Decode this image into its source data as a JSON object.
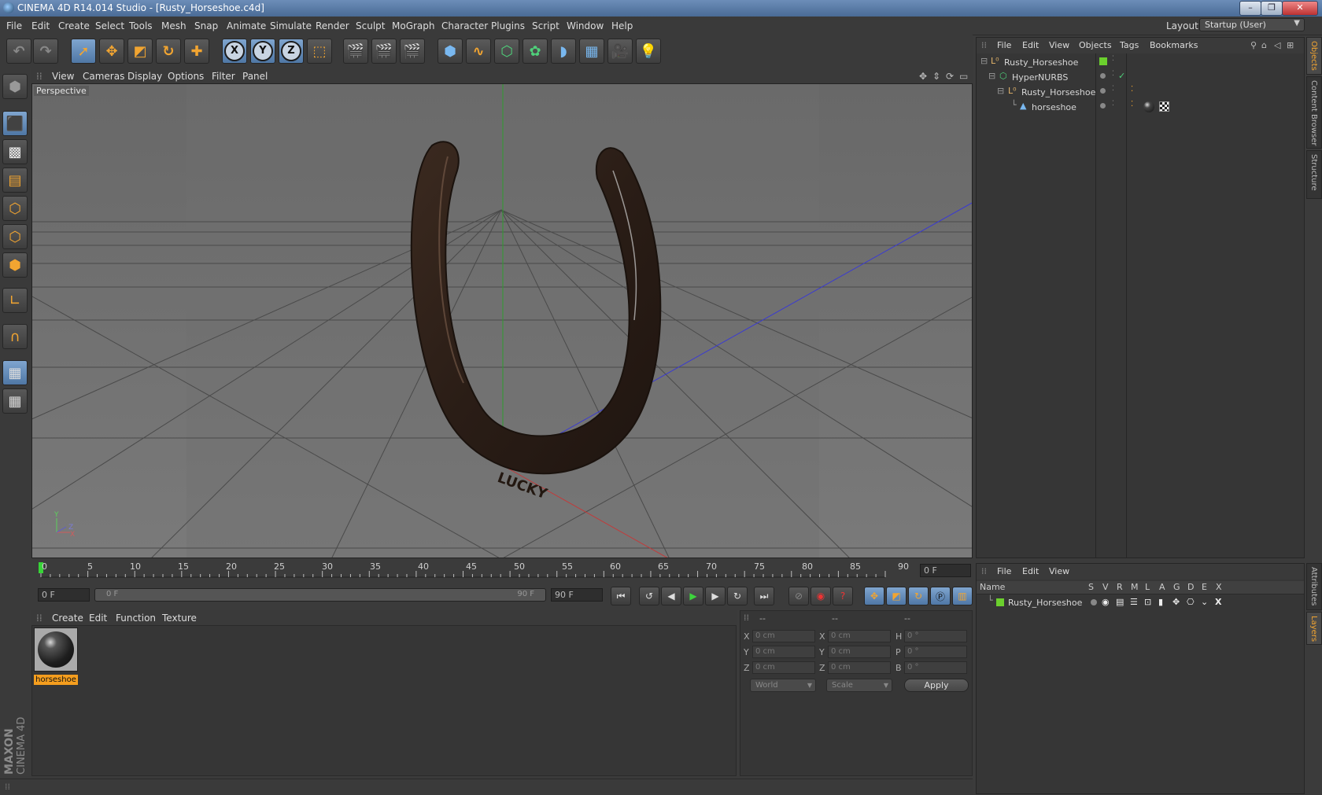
{
  "window": {
    "title": "CINEMA 4D R14.014 Studio - [Rusty_Horseshoe.c4d]"
  },
  "menubar": {
    "items": [
      "File",
      "Edit",
      "Create",
      "Select",
      "Tools",
      "Mesh",
      "Snap",
      "Animate",
      "Simulate",
      "Render",
      "Sculpt",
      "MoGraph",
      "Character",
      "Plugins",
      "Script",
      "Window",
      "Help"
    ],
    "layout_label": "Layout:",
    "layout_value": "Startup (User)"
  },
  "toolbar": {
    "axis_x": "X",
    "axis_y": "Y",
    "axis_z": "Z"
  },
  "viewport": {
    "menu": [
      "View",
      "Cameras",
      "Display",
      "Options",
      "Filter",
      "Panel"
    ],
    "label": "Perspective",
    "axis_y": "Y",
    "axis_x": "X",
    "axis_z": "Z",
    "object_text": "LUCKY"
  },
  "timeline": {
    "ticks": [
      "0",
      "5",
      "10",
      "15",
      "20",
      "25",
      "30",
      "35",
      "40",
      "45",
      "50",
      "55",
      "60",
      "65",
      "70",
      "75",
      "80",
      "85",
      "90"
    ],
    "current_frame": "0 F"
  },
  "playbar": {
    "start_field": "0 F",
    "range_start": "0 F",
    "range_end": "90 F",
    "end_field": "90 F"
  },
  "material_manager": {
    "menu": [
      "Create",
      "Edit",
      "Function",
      "Texture"
    ],
    "materials": [
      {
        "name": "horseshoe"
      }
    ]
  },
  "coordinates": {
    "header": [
      "--",
      "--",
      "--"
    ],
    "rows": [
      {
        "l1": "X",
        "v1": "0 cm",
        "l2": "X",
        "v2": "0 cm",
        "l3": "H",
        "v3": "0 °"
      },
      {
        "l1": "Y",
        "v1": "0 cm",
        "l2": "Y",
        "v2": "0 cm",
        "l3": "P",
        "v3": "0 °"
      },
      {
        "l1": "Z",
        "v1": "0 cm",
        "l2": "Z",
        "v2": "0 cm",
        "l3": "B",
        "v3": "0 °"
      }
    ],
    "mode_dropdown": "World",
    "scale_dropdown": "Scale",
    "apply_label": "Apply"
  },
  "object_manager": {
    "menu": [
      "File",
      "Edit",
      "View",
      "Objects",
      "Tags",
      "Bookmarks"
    ],
    "objects": [
      {
        "name": "Rusty_Horseshoe"
      },
      {
        "name": "HyperNURBS"
      },
      {
        "name": "Rusty_Horseshoe"
      },
      {
        "name": "horseshoe"
      }
    ]
  },
  "layer_manager": {
    "menu": [
      "File",
      "Edit",
      "View"
    ],
    "columns": [
      "Name",
      "S",
      "V",
      "R",
      "M",
      "L",
      "A",
      "G",
      "D",
      "E",
      "X"
    ],
    "layers": [
      {
        "name": "Rusty_Horseshoe",
        "color": "#6bd02d"
      }
    ]
  },
  "side_tabs": {
    "top": [
      "Objects",
      "Content Browser",
      "Structure"
    ],
    "bottom": [
      "Attributes",
      "Layers"
    ]
  },
  "branding": {
    "maxon": "MAXON",
    "cinema": "CINEMA 4D"
  }
}
